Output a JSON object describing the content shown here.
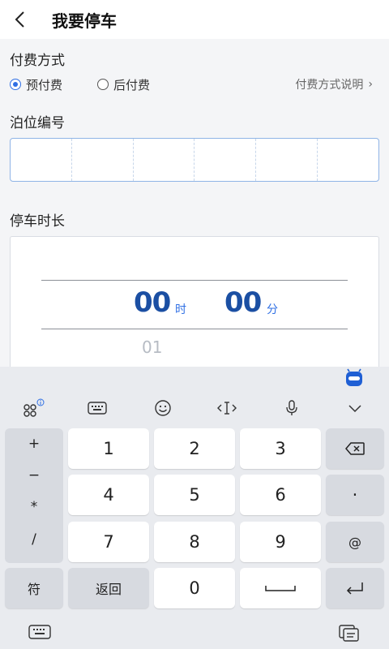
{
  "header": {
    "title": "我要停车",
    "back_icon": "back-arrow-icon"
  },
  "payment": {
    "title": "付费方式",
    "options": [
      {
        "label": "预付费",
        "checked": true
      },
      {
        "label": "后付费",
        "checked": false
      }
    ],
    "help_label": "付费方式说明",
    "help_chevron": "›"
  },
  "berth": {
    "title": "泊位编号",
    "cells": [
      "",
      "",
      "",
      "",
      "",
      ""
    ]
  },
  "duration": {
    "title": "停车时长",
    "hours": "00",
    "hours_unit": "时",
    "minutes": "00",
    "minutes_unit": "分",
    "next_hours": "01"
  },
  "keyboard": {
    "toolbar_icons": [
      "apps-icon",
      "keyboard-icon",
      "emoji-icon",
      "cursor-icon",
      "mic-icon",
      "collapse-icon"
    ],
    "symbols": [
      "+",
      "−",
      "*",
      "/"
    ],
    "digits": [
      "1",
      "2",
      "3",
      "4",
      "5",
      "6",
      "7",
      "8",
      "9",
      "0"
    ],
    "dot": "·",
    "at": "@",
    "symbol_key": "符",
    "return_key": "返回",
    "accent_color": "#2f6fe4"
  }
}
